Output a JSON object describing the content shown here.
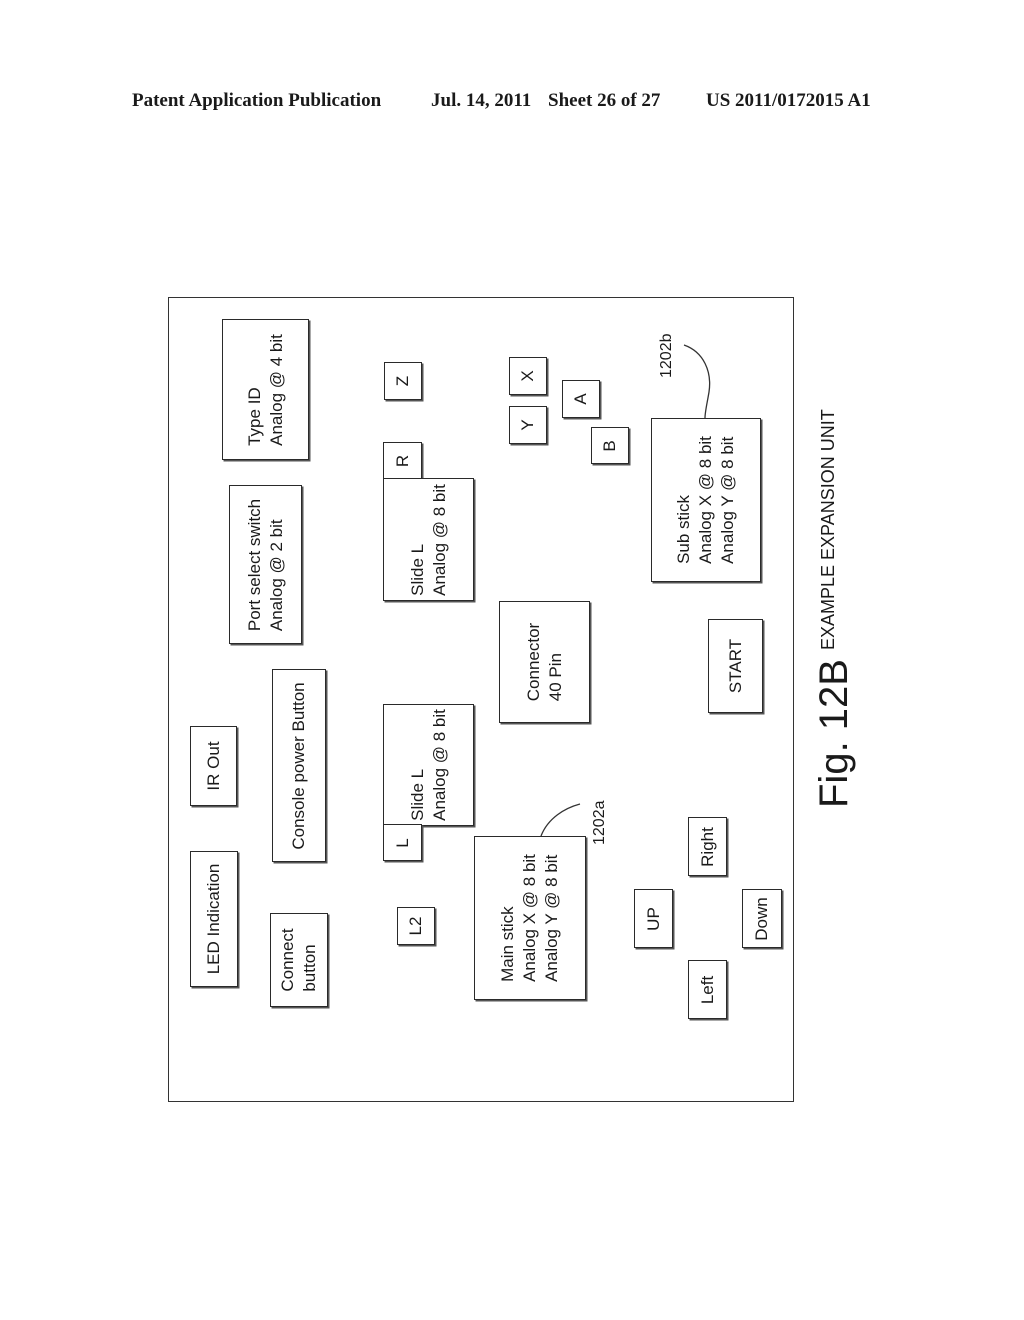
{
  "header": {
    "publication": "Patent Application Publication",
    "date": "Jul. 14, 2011",
    "sheet": "Sheet 26 of 27",
    "number": "US 2011/0172015 A1"
  },
  "figure": {
    "label": "Fig. 12B",
    "title": "EXAMPLE EXPANSION UNIT"
  },
  "blocks": {
    "type_id": [
      "Type ID",
      "Analog @ 4 bit"
    ],
    "port_select": [
      "Port select switch",
      "Analog @ 2 bit"
    ],
    "console_power": [
      "Console power Button"
    ],
    "ir_out": [
      "IR Out"
    ],
    "led_indication": [
      "LED Indication"
    ],
    "connect_button": [
      "Connect",
      "button"
    ],
    "slide_r": [
      "Slide L",
      "Analog @ 8 bit"
    ],
    "slide_l": [
      "Slide L",
      "Analog @ 8 bit"
    ],
    "connector": [
      "Connector",
      "40 Pin"
    ],
    "main_stick": [
      "Main stick",
      "Analog X @ 8 bit",
      "Analog Y @ 8 bit"
    ],
    "sub_stick": [
      "Sub stick",
      "Analog X @ 8 bit",
      "Analog Y @ 8 bit"
    ],
    "start": [
      "START"
    ]
  },
  "buttons": {
    "z": "Z",
    "r": "R",
    "l": "L",
    "l2": "L2",
    "x": "X",
    "y": "Y",
    "a": "A",
    "b": "B",
    "up": "UP",
    "down": "Down",
    "left": "Left",
    "right": "Right"
  },
  "refs": {
    "main_stick": "1202a",
    "sub_stick": "1202b"
  }
}
